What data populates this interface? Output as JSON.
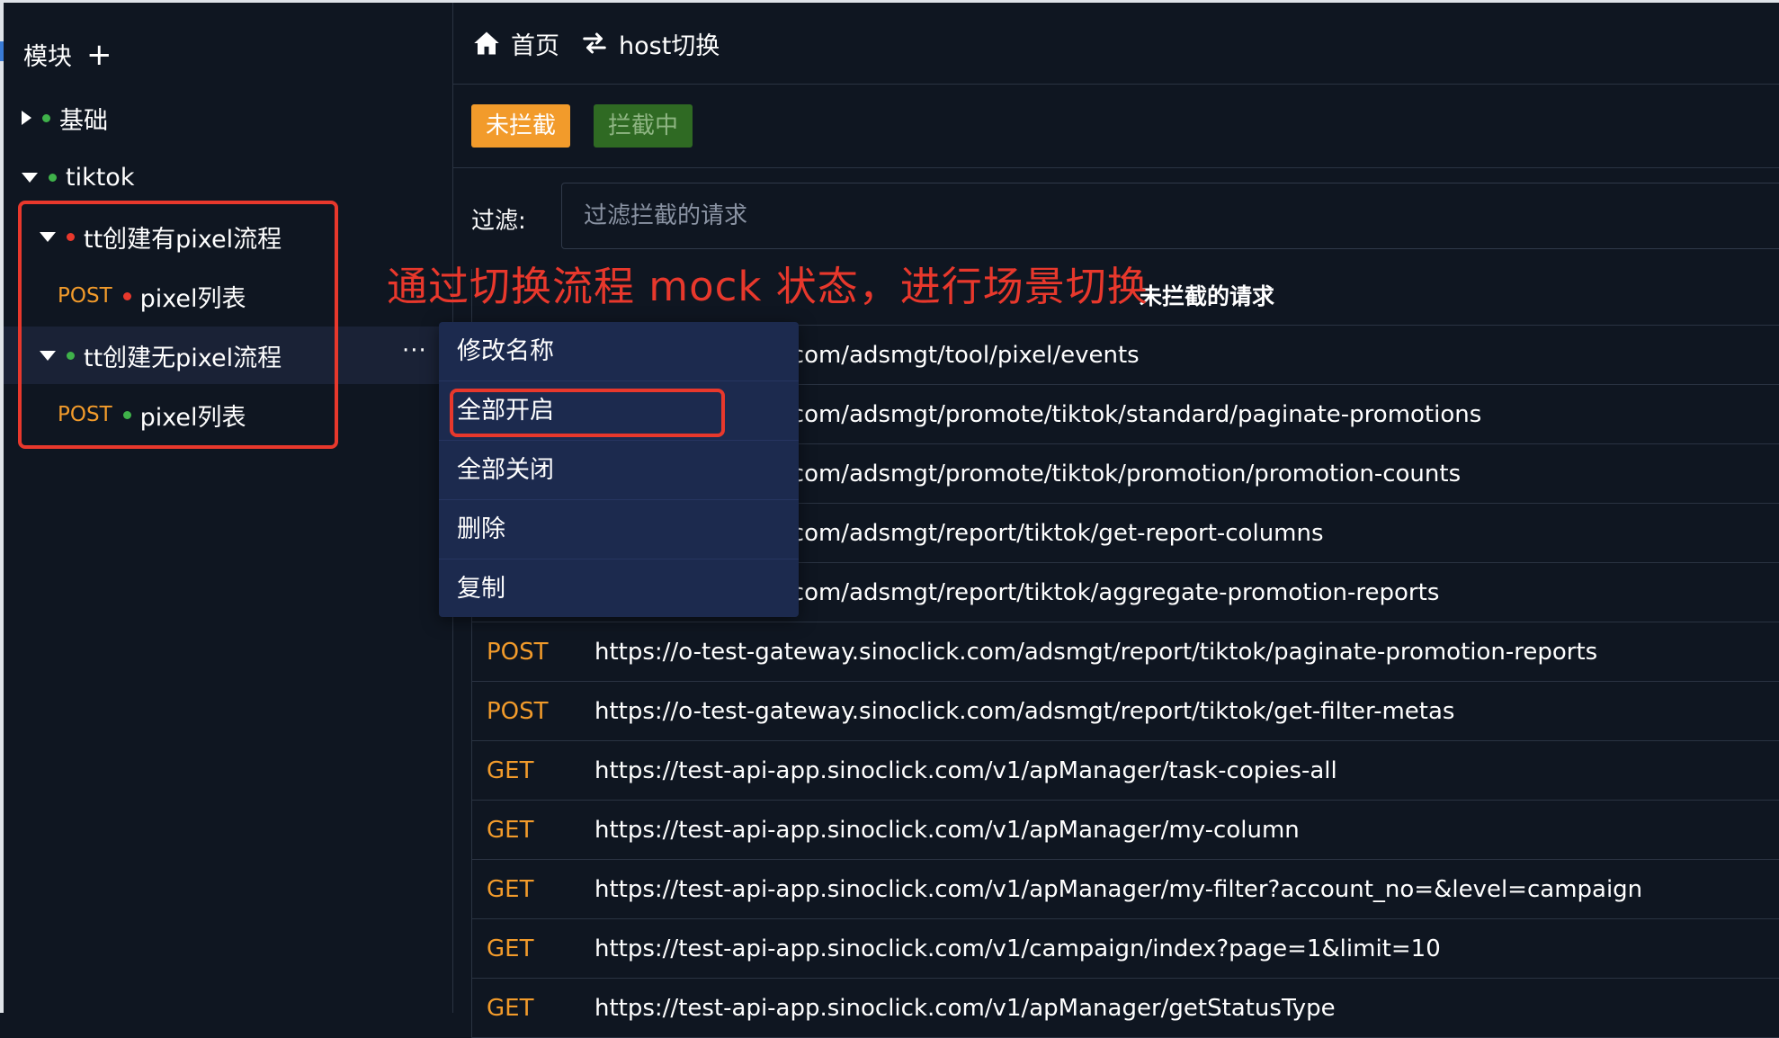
{
  "sidebar": {
    "header": "模块",
    "add_icon": "+",
    "items": [
      {
        "label": "基础",
        "dot_color": "#3fb24a",
        "expanded": false
      },
      {
        "label": "tiktok",
        "dot_color": "#3fb24a",
        "expanded": true
      },
      {
        "label": "tt创建有pixel流程",
        "dot_color": "#e8382c",
        "expanded": true
      },
      {
        "method": "POST",
        "label": "pixel列表",
        "dot_color": "#e8382c"
      },
      {
        "label": "tt创建无pixel流程",
        "dot_color": "#3fb24a",
        "expanded": true
      },
      {
        "method": "POST",
        "label": "pixel列表",
        "dot_color": "#3fb24a"
      }
    ],
    "more_icon": "···"
  },
  "nav": {
    "home_label": "首页",
    "home_icon": "home-icon",
    "switch_label": "host切换",
    "switch_icon": "swap-icon"
  },
  "buttons": {
    "not_intercepted": "未拦截",
    "intercepting": "拦截中"
  },
  "filter": {
    "label": "过滤:",
    "placeholder": "过滤拦截的请求"
  },
  "table": {
    "title": "未拦截的请求",
    "rows": [
      {
        "method": "",
        "url": "ateway.sinoclick.com/adsmgt/tool/pixel/events"
      },
      {
        "method": "",
        "url": "ateway.sinoclick.com/adsmgt/promote/tiktok/standard/paginate-promotions"
      },
      {
        "method": "",
        "url": "ateway.sinoclick.com/adsmgt/promote/tiktok/promotion/promotion-counts"
      },
      {
        "method": "",
        "url": "ateway.sinoclick.com/adsmgt/report/tiktok/get-report-columns"
      },
      {
        "method": "",
        "url": "ateway.sinoclick.com/adsmgt/report/tiktok/aggregate-promotion-reports"
      },
      {
        "method": "POST",
        "url": "https://o-test-gateway.sinoclick.com/adsmgt/report/tiktok/paginate-promotion-reports"
      },
      {
        "method": "POST",
        "url": "https://o-test-gateway.sinoclick.com/adsmgt/report/tiktok/get-filter-metas"
      },
      {
        "method": "GET",
        "url": "https://test-api-app.sinoclick.com/v1/apManager/task-copies-all"
      },
      {
        "method": "GET",
        "url": "https://test-api-app.sinoclick.com/v1/apManager/my-column"
      },
      {
        "method": "GET",
        "url": "https://test-api-app.sinoclick.com/v1/apManager/my-filter?account_no=&level=campaign"
      },
      {
        "method": "GET",
        "url": "https://test-api-app.sinoclick.com/v1/campaign/index?page=1&limit=10"
      },
      {
        "method": "GET",
        "url": "https://test-api-app.sinoclick.com/v1/apManager/getStatusType"
      }
    ]
  },
  "annotation": "通过切换流程 mock 状态，进行场景切换",
  "context_menu": {
    "items": [
      "修改名称",
      "全部开启",
      "全部关闭",
      "删除",
      "复制"
    ],
    "highlighted_index": 1
  },
  "colors": {
    "background": "#0f1621",
    "accent_orange": "#f29b2b",
    "accent_green": "#2f6a23",
    "annotation_red": "#e8382c",
    "menu_bg": "#1c2a4e"
  }
}
